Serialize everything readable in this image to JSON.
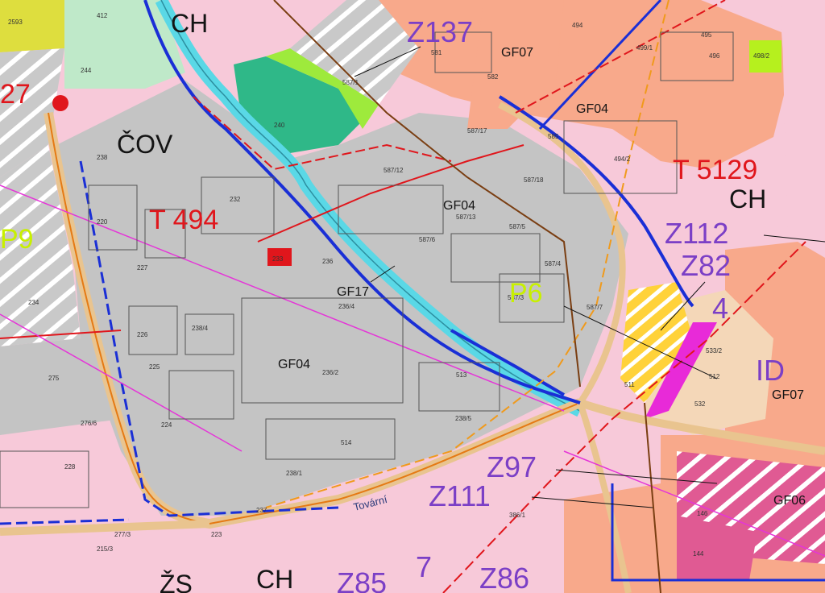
{
  "labels": {
    "ch_top": "CH",
    "cov": "ČOV",
    "z137": "Z137",
    "gf07_top": "GF07",
    "gf04_top": "GF04",
    "t5129": "T 5129",
    "ch_right": "CH",
    "t494": "T 494",
    "gf04_mid": "GF04",
    "z112": "Z112",
    "z82": "Z82",
    "p6": "P6",
    "gf17": "GF17",
    "num4": "4",
    "gf04_low": "GF04",
    "id": "ID",
    "gf07_right": "GF07",
    "z97": "Z97",
    "z111": "Z111",
    "gf06": "GF06",
    "zs": "ŽS",
    "ch_bottom": "CH",
    "z85": "Z85",
    "num7": "7",
    "z86": "Z86",
    "num27": "27",
    "p9": "P9",
    "street": "Tovární"
  },
  "parcels": {
    "p412": "412",
    "p244": "244",
    "p240": "240",
    "p238": "238",
    "p220": "220",
    "p232": "232",
    "p227": "227",
    "p226": "226",
    "p225": "225",
    "p224": "224",
    "p233": "233",
    "p236": "236",
    "p236_4": "236/4",
    "p236_2": "236/2",
    "p238_4": "238/4",
    "p238_1": "238/1",
    "p228": "228",
    "p237": "237",
    "p223": "223",
    "p234": "234",
    "p275": "275",
    "p276_6": "276/6",
    "p587_1": "587/1",
    "p587_12": "587/12",
    "p587_13": "587/13",
    "p587_6": "587/6",
    "p587_5": "587/5",
    "p587_4": "587/4",
    "p587_3": "587/3",
    "p587_7": "587/7",
    "p587_17": "587/17",
    "p587_18": "587/18",
    "p513": "513",
    "p514": "514",
    "p238_5": "238/5",
    "p581": "581",
    "p582": "582",
    "p494": "494",
    "p495": "495",
    "p496": "496",
    "p498_2": "498/2",
    "p499_1": "499/1",
    "p494_2": "494/2",
    "p585": "585",
    "p386_1": "386/1",
    "p532": "532",
    "p512": "512",
    "p511": "511",
    "p533_2": "533/2",
    "p146": "146",
    "p144": "144",
    "p277_3": "277/3",
    "p215_3": "215/3",
    "p2593": "2593"
  },
  "colors": {
    "industrial_gray": "#c4c4c4",
    "residential_salmon": "#f8a98b",
    "green_space": "#2fb888",
    "river_cyan": "#5ad8e6",
    "main_road": "#e9c48f",
    "transport_pink": "#f7c9d9",
    "planned_red": "#e0161c",
    "boundary_blue": "#1a2fd6",
    "label_purple": "#7b3fc6",
    "yellow_zone": "#ffd23a",
    "magenta_zone": "#e23c8f",
    "lime": "#b6f01e"
  }
}
